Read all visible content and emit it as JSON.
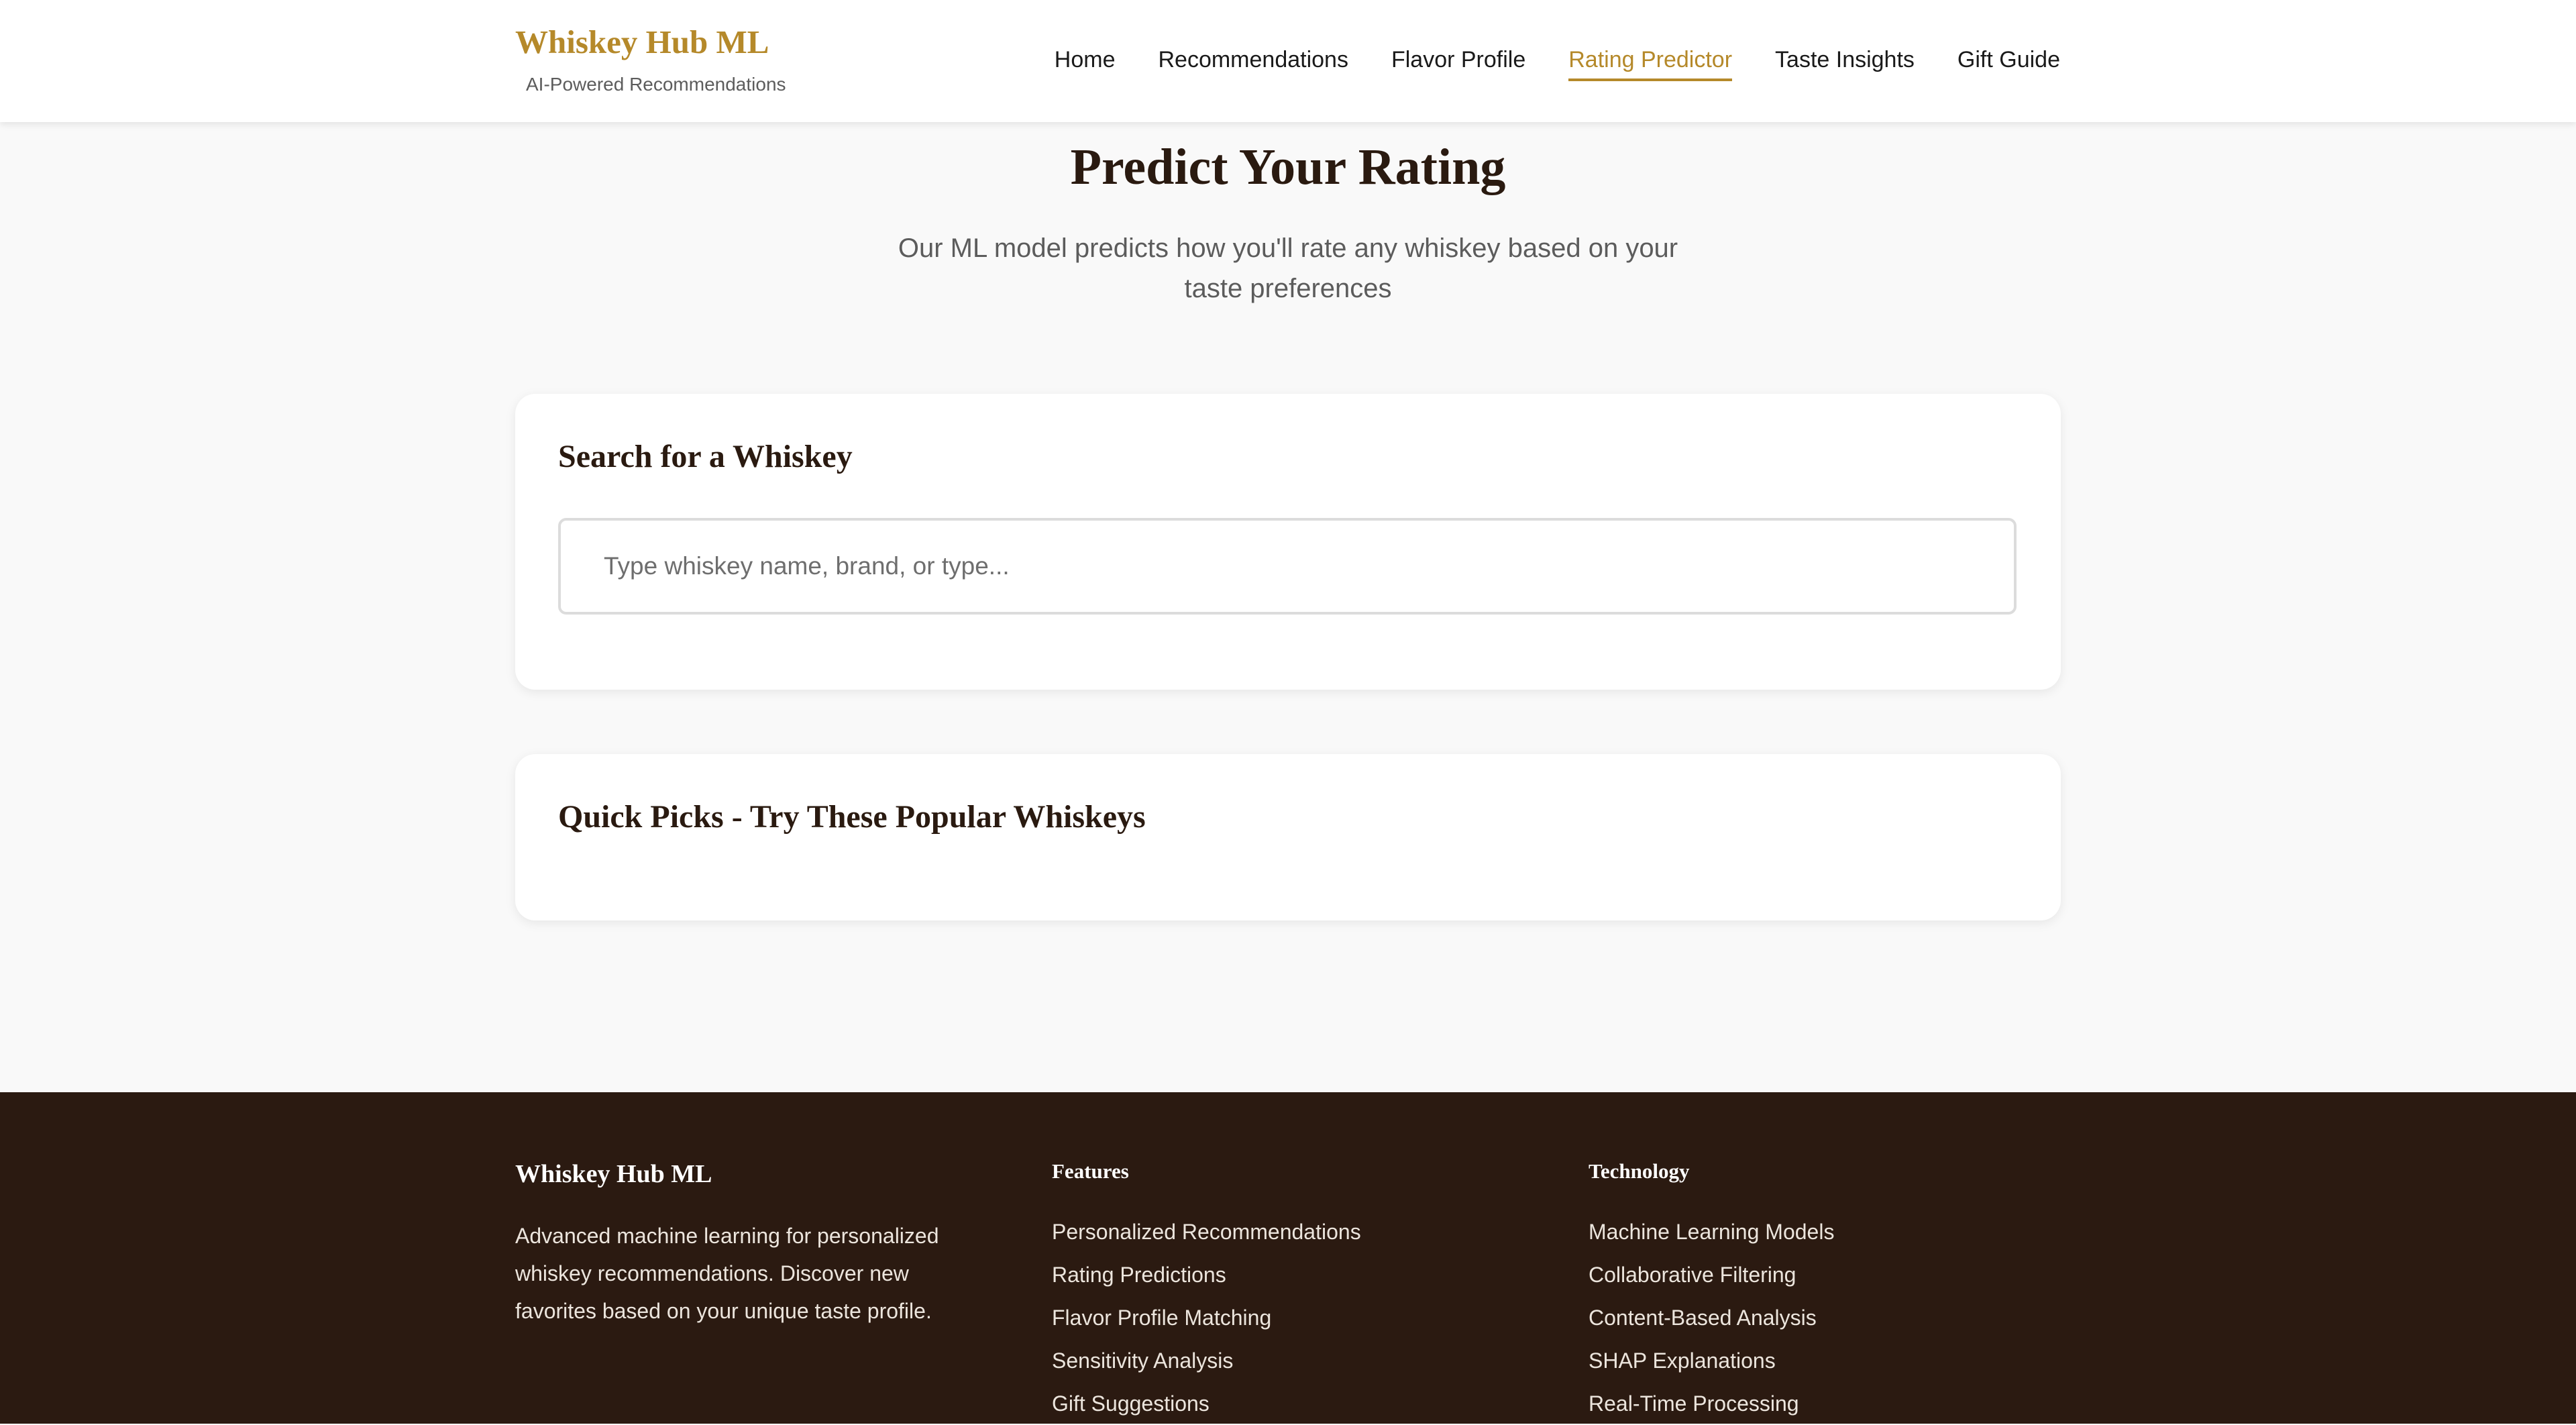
{
  "header": {
    "brand": "Whiskey Hub ML",
    "tagline": "AI-Powered Recommendations",
    "nav": [
      {
        "label": "Home"
      },
      {
        "label": "Recommendations"
      },
      {
        "label": "Flavor Profile"
      },
      {
        "label": "Rating Predictor",
        "active": true
      },
      {
        "label": "Taste Insights"
      },
      {
        "label": "Gift Guide"
      }
    ]
  },
  "hero": {
    "title": "Predict Your Rating",
    "subtitle": "Our ML model predicts how you'll rate any whiskey based on your taste preferences"
  },
  "search": {
    "title": "Search for a Whiskey",
    "placeholder": "Type whiskey name, brand, or type...",
    "value": ""
  },
  "quick_picks": {
    "title": "Quick Picks - Try These Popular Whiskeys"
  },
  "footer": {
    "brand": "Whiskey Hub ML",
    "about": "Advanced machine learning for personalized whiskey recommendations. Discover new favorites based on your unique taste profile.",
    "features": {
      "heading": "Features",
      "items": [
        "Personalized Recommendations",
        "Rating Predictions",
        "Flavor Profile Matching",
        "Sensitivity Analysis",
        "Gift Suggestions"
      ]
    },
    "technology": {
      "heading": "Technology",
      "items": [
        "Machine Learning Models",
        "Collaborative Filtering",
        "Content-Based Analysis",
        "SHAP Explanations",
        "Real-Time Processing"
      ]
    }
  },
  "colors": {
    "brand": "#b5892a",
    "text_dark": "#2a1a10",
    "footer_bg": "#2b1a11",
    "page_bg": "#f9f9f9"
  }
}
